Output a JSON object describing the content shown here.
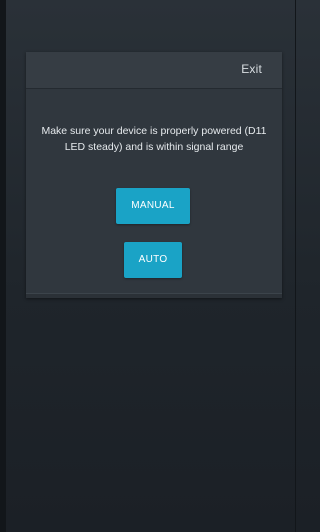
{
  "dialog": {
    "exit_label": "Exit",
    "message": "Make sure your device is properly powered (D11 LED steady) and is within signal range",
    "manual_label": "MANUAL",
    "auto_label": "AUTO"
  },
  "colors": {
    "background": "#1f252b",
    "dialog": "#30373e",
    "button": "#1aa3c6"
  }
}
